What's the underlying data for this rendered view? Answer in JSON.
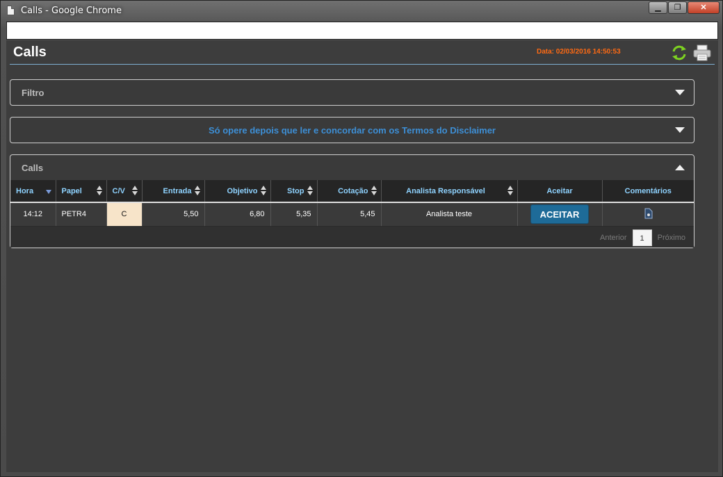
{
  "window": {
    "title": "Calls - Google Chrome",
    "minimize_icon": "minimize-icon",
    "maximize_icon": "restore-icon",
    "close_icon": "close-icon"
  },
  "header": {
    "title": "Calls",
    "date_text": "Data: 02/03/2016 14:50:53",
    "date_color": "#ff6a13",
    "refresh_icon": "refresh-icon",
    "print_icon": "print-icon"
  },
  "filter_panel": {
    "label": "Filtro"
  },
  "disclaimer_panel": {
    "label": "Só opere depois que ler e concordar com os Termos do Disclaimer"
  },
  "calls_panel": {
    "label": "Calls",
    "columns": [
      "Hora",
      "Papel",
      "C/V",
      "Entrada",
      "Objetivo",
      "Stop",
      "Cotação",
      "Analista Responsável",
      "Aceitar",
      "Comentários"
    ],
    "rows": [
      {
        "hora": "14:12",
        "papel": "PETR4",
        "cv": "C",
        "entrada": "5,50",
        "objetivo": "6,80",
        "stop": "5,35",
        "cotacao": "5,45",
        "analista": "Analista teste",
        "aceitar": "ACEITAR"
      }
    ],
    "pager": {
      "prev": "Anterior",
      "page": "1",
      "next": "Próximo"
    }
  }
}
